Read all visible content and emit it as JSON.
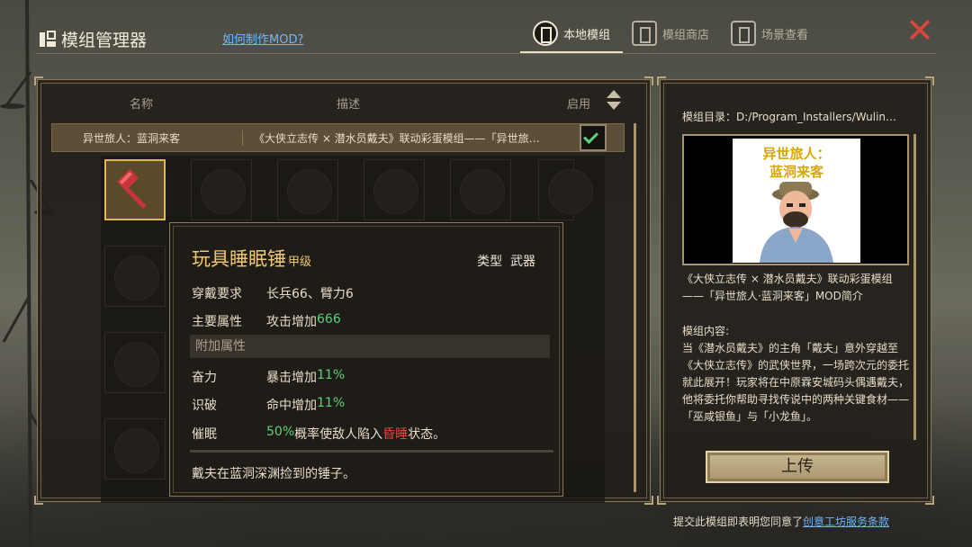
{
  "header": {
    "title": "模组管理器",
    "help_link": "如何制作MOD?",
    "tabs": [
      {
        "label": "本地模组",
        "icon": "book-icon",
        "active": true
      },
      {
        "label": "模组商店",
        "icon": "shop-icon",
        "active": false
      },
      {
        "label": "场景查看",
        "icon": "scene-icon",
        "active": false
      }
    ]
  },
  "mod_list": {
    "columns": {
      "name": "名称",
      "description": "描述",
      "enabled": "启用"
    },
    "rows": [
      {
        "name": "异世旅人：蓝洞来客",
        "description": "《大侠立志传 × 潜水员戴夫》联动彩蛋模组——「异世旅…",
        "enabled": true
      }
    ]
  },
  "tooltip": {
    "item_name": "玩具睡眠锤",
    "grade": "甲级",
    "type_label": "类型",
    "type_value": "武器",
    "requirement_label": "穿戴要求",
    "requirement_value": "长兵66、臂力6",
    "main_attr_label": "主要属性",
    "main_attr_text": "攻击增加 ",
    "main_attr_value": "666",
    "extra_section": "附加属性",
    "extras": [
      {
        "label": "奋力",
        "text": "暴击增加 ",
        "value": "11%"
      },
      {
        "label": "识破",
        "text": "命中增加 ",
        "value": "11%"
      }
    ],
    "hypnosis_label": "催眠",
    "hypnosis_pct": "50%",
    "hypnosis_mid": "概率使敌人陷入",
    "hypnosis_status": "昏睡",
    "hypnosis_end": "状态。",
    "flavor": "戴夫在蓝洞深渊捡到的锤子。"
  },
  "detail": {
    "directory": "模组目录：D:/Program_Installers/Wulin…",
    "preview_line1": "异世旅人：",
    "preview_line2": "蓝洞来客",
    "summary": "《大侠立志传 × 潜水员戴夫》联动彩蛋模组——「异世旅人·蓝洞来客」MOD简介",
    "content_label": "模组内容:",
    "content": "当《潜水员戴夫》的主角「戴夫」意外穿越至《大侠立志传》的武侠世界，一场跨次元的委托就此展开！玩家将在中原霖安城码头偶遇戴夫，他将委托你帮助寻找传说中的两种关键食材——「巫咸银鱼」与「小龙鱼」。",
    "upload_label": "上传"
  },
  "footer": {
    "terms_prefix": "提交此模组即表明您同意了",
    "terms_link": "创意工坊服务条款"
  },
  "colors": {
    "accent_gold": "#f0c76a",
    "positive_green": "#5fd07a",
    "status_red": "#e04a3c",
    "link_blue": "#6fb6ff",
    "close_red": "#d9463c"
  }
}
